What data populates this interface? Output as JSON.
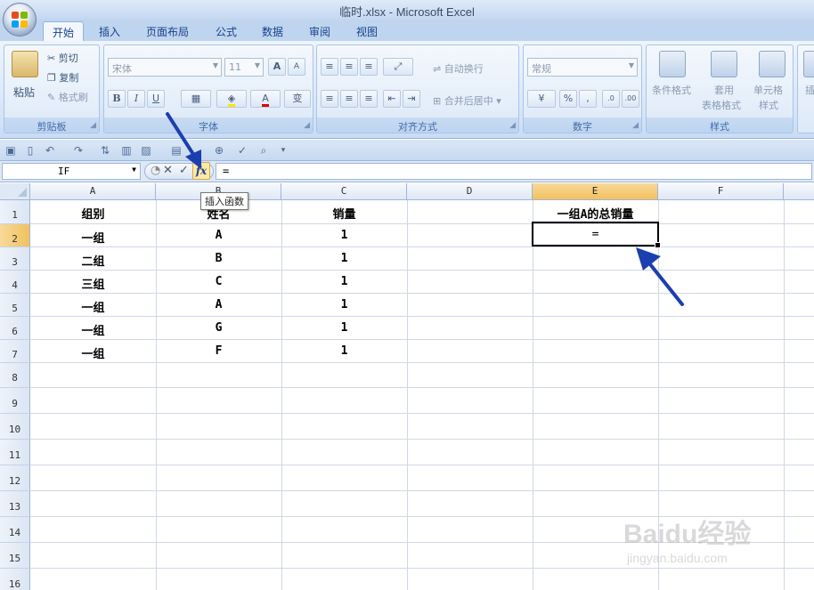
{
  "window": {
    "title": "临时.xlsx - Microsoft Excel"
  },
  "ribbon": {
    "tabs": [
      "开始",
      "插入",
      "页面布局",
      "公式",
      "数据",
      "审阅",
      "视图"
    ],
    "clipboard": {
      "paste": "粘贴",
      "cut": "剪切",
      "copy": "复制",
      "format_painter": "格式刷",
      "label": "剪贴板"
    },
    "font": {
      "name": "宋体",
      "size": "11",
      "label": "字体",
      "bold": "B",
      "italic": "I",
      "underline": "U",
      "grow": "A",
      "shrink": "A",
      "color": "A",
      "phonetic": "变"
    },
    "alignment": {
      "wrap": "自动换行",
      "merge": "合并后居中",
      "label": "对齐方式"
    },
    "number": {
      "format": "常规",
      "percent": "%",
      "comma": ",",
      "label": "数字"
    },
    "styles": {
      "conditional": "条件格式",
      "table_line1": "套用",
      "table_line2": "表格格式",
      "cell_line1": "单元格",
      "cell_line2": "样式",
      "label": "样式"
    },
    "insert_partial": "插"
  },
  "formula_bar": {
    "name_box": "IF",
    "formula": "=",
    "fx_label": "fx",
    "fx_tooltip": "插入函数"
  },
  "sheet": {
    "columns": [
      "A",
      "B",
      "C",
      "D",
      "E",
      "F"
    ],
    "selected_column": "E",
    "rows": [
      "1",
      "2",
      "3",
      "4",
      "5",
      "6",
      "7",
      "8",
      "9",
      "10",
      "11",
      "12",
      "13",
      "14",
      "15",
      "16"
    ],
    "selected_row": "2",
    "cells": {
      "A1": "组别",
      "B1": "姓名",
      "C1": "销量",
      "E1": "一组A的总销量",
      "A2": "一组",
      "B2": "A",
      "C2": "1",
      "E2": "=",
      "A3": "二组",
      "B3": "B",
      "C3": "1",
      "A4": "三组",
      "B4": "C",
      "C4": "1",
      "A5": "一组",
      "B5": "A",
      "C5": "1",
      "A6": "一组",
      "B6": "G",
      "C6": "1",
      "A7": "一组",
      "B7": "F",
      "C7": "1"
    }
  },
  "watermark": {
    "brand": "Baidu经验",
    "url": "jingyan.baidu.com"
  },
  "colors": {
    "arrow": "#1b3fb0",
    "selection": "#f1c15f",
    "ribbon": "#dbe7f6"
  }
}
